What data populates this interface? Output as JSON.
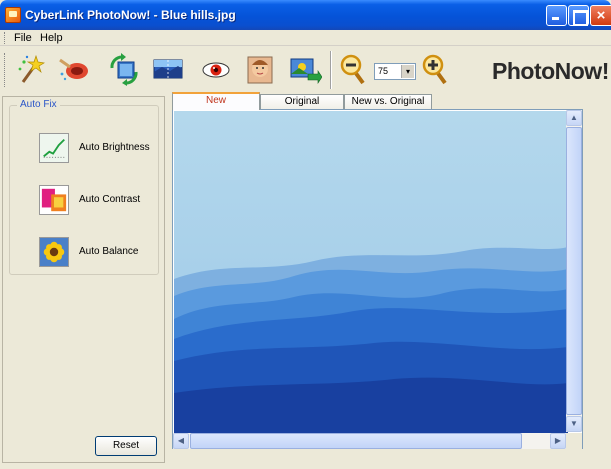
{
  "window": {
    "title": "CyberLink PhotoNow! - Blue hills.jpg",
    "close_glyph": "×"
  },
  "menu": {
    "file": "File",
    "help": "Help"
  },
  "toolbar": {
    "tools": [
      "magic-wand-icon",
      "red-eye-brush-icon",
      "rotate-icon",
      "panorama-icon",
      "red-eye-icon",
      "face-icon",
      "photo-export-icon"
    ],
    "zoom_value": "75",
    "zoom_arrow": "▾",
    "brand": "PhotoNow!"
  },
  "left_panel": {
    "group_label": "Auto Fix",
    "fixes": [
      {
        "label": "Auto Brightness",
        "icon": "brightness-chart-icon"
      },
      {
        "label": "Auto Contrast",
        "icon": "contrast-icon"
      },
      {
        "label": "Auto Balance",
        "icon": "sunflower-icon"
      }
    ],
    "reset_label": "Reset"
  },
  "tabs": [
    {
      "label": "New",
      "active": true
    },
    {
      "label": "Original",
      "active": false
    },
    {
      "label": "New vs. Original",
      "active": false
    }
  ],
  "scroll": {
    "up": "▲",
    "down": "▼",
    "left": "◀",
    "right": "▶"
  },
  "colors": {
    "accent": "#2a55c8",
    "active_tab_text": "#c0341c",
    "title_bar": "#0553d8"
  }
}
